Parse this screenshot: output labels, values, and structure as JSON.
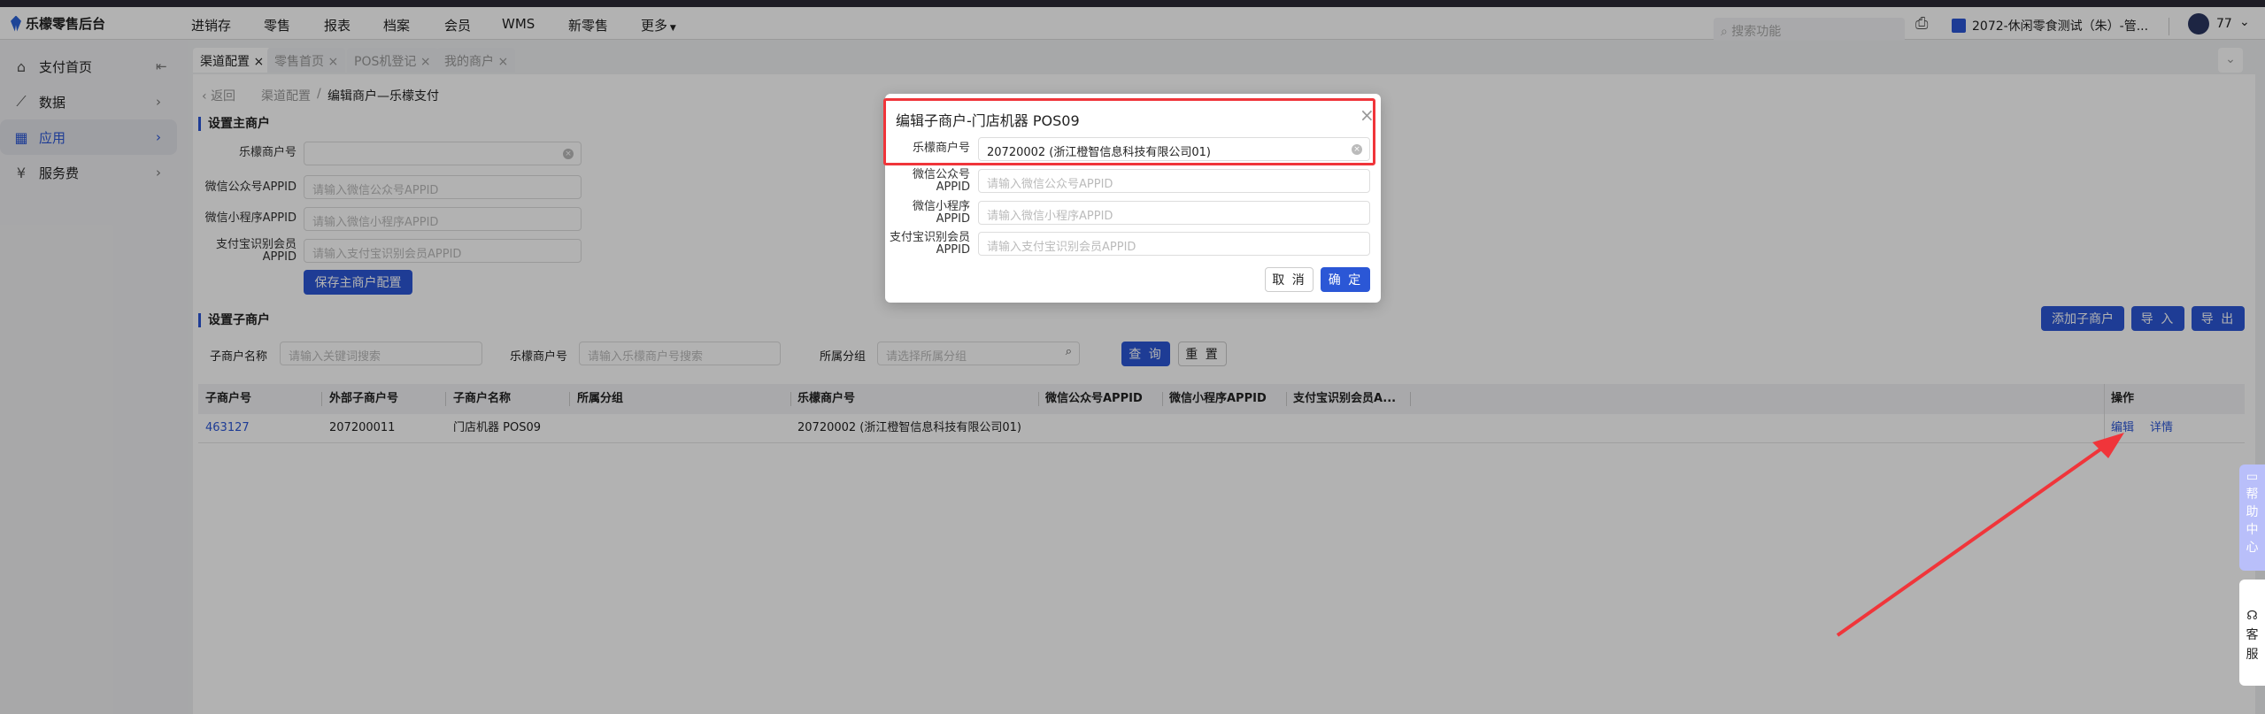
{
  "app": {
    "title": "乐檬零售后台"
  },
  "topnav": {
    "items": [
      "进销存",
      "零售",
      "报表",
      "档案",
      "会员",
      "WMS",
      "新零售",
      "更多"
    ],
    "search_placeholder": "搜索功能",
    "store": "2072-休闲零食测试（朱）-管...",
    "user": "77"
  },
  "sidebar": {
    "items": [
      {
        "label": "支付首页",
        "icon": "home-icon"
      },
      {
        "label": "数据",
        "icon": "chart-icon"
      },
      {
        "label": "应用",
        "icon": "grid-icon",
        "active": true
      },
      {
        "label": "服务费",
        "icon": "yen-icon"
      }
    ]
  },
  "tabs": [
    "渠道配置",
    "零售首页",
    "POS机登记",
    "我的商户"
  ],
  "breadcrumb": {
    "back": "返回",
    "parent": "渠道配置",
    "current": "编辑商户—乐檬支付"
  },
  "main_merchant": {
    "title": "设置主商户",
    "fields": [
      {
        "label": "乐檬商户号",
        "placeholder": ""
      },
      {
        "label": "微信公众号APPID",
        "placeholder": "请输入微信公众号APPID"
      },
      {
        "label": "微信小程序APPID",
        "placeholder": "请输入微信小程序APPID"
      },
      {
        "label": "支付宝识别会员APPID",
        "placeholder": "请输入支付宝识别会员APPID"
      }
    ],
    "save": "保存主商户配置"
  },
  "sub_merchant": {
    "title": "设置子商户",
    "add": "添加子商户",
    "import": "导 入",
    "export": "导 出",
    "filters": [
      {
        "label": "子商户名称",
        "placeholder": "请输入关键词搜索"
      },
      {
        "label": "乐檬商户号",
        "placeholder": "请输入乐檬商户号搜索"
      },
      {
        "label": "所属分组",
        "placeholder": "请选择所属分组"
      }
    ],
    "query": "查 询",
    "reset": "重 置",
    "columns": [
      "子商户号",
      "外部子商户号",
      "子商户名称",
      "所属分组",
      "乐檬商户号",
      "微信公众号APPID",
      "微信小程序APPID",
      "支付宝识别会员A...",
      "操作"
    ],
    "rows": [
      {
        "id": "463127",
        "ext": "207200011",
        "name": "门店机器 POS09",
        "group": "",
        "lemeng": "20720002 (浙江橙智信息科技有限公司01)",
        "edit": "编辑",
        "detail": "详情"
      }
    ]
  },
  "dialog": {
    "title": "编辑子商户-门店机器 POS09",
    "fields": [
      {
        "label": "乐檬商户号",
        "value": "20720002 (浙江橙智信息科技有限公司01)"
      },
      {
        "label": "微信公众号APPID",
        "placeholder": "请输入微信公众号APPID"
      },
      {
        "label": "微信小程序APPID",
        "placeholder": "请输入微信小程序APPID"
      },
      {
        "label": "支付宝识别会员APPID",
        "placeholder": "请输入支付宝识别会员APPID"
      }
    ],
    "cancel": "取 消",
    "confirm": "确 定"
  },
  "widgets": {
    "help": "帮助中心",
    "service": "客服"
  },
  "colors": {
    "primary": "#2b57d6",
    "annotation": "#f0353a"
  }
}
